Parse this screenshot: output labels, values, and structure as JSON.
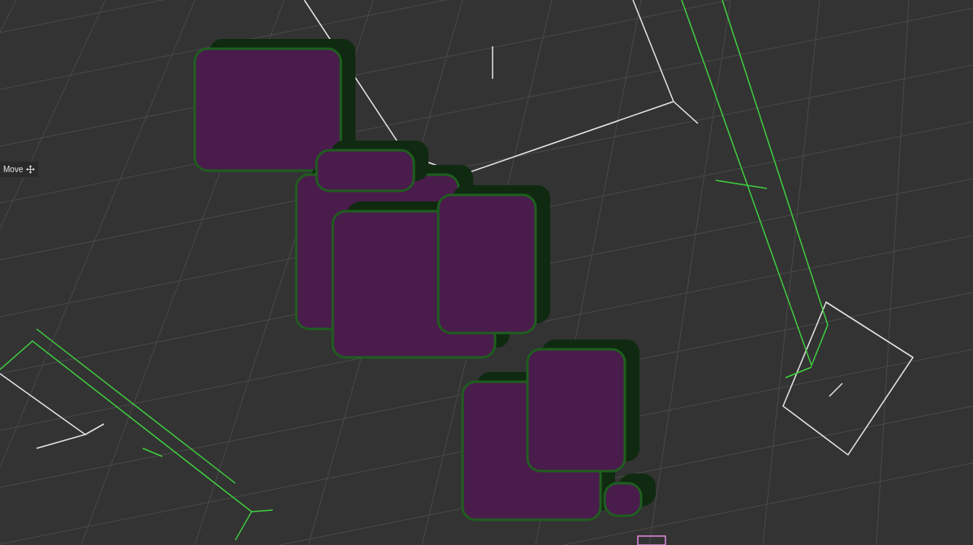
{
  "viewport": {
    "tool_label": {
      "text": "Move"
    }
  }
}
